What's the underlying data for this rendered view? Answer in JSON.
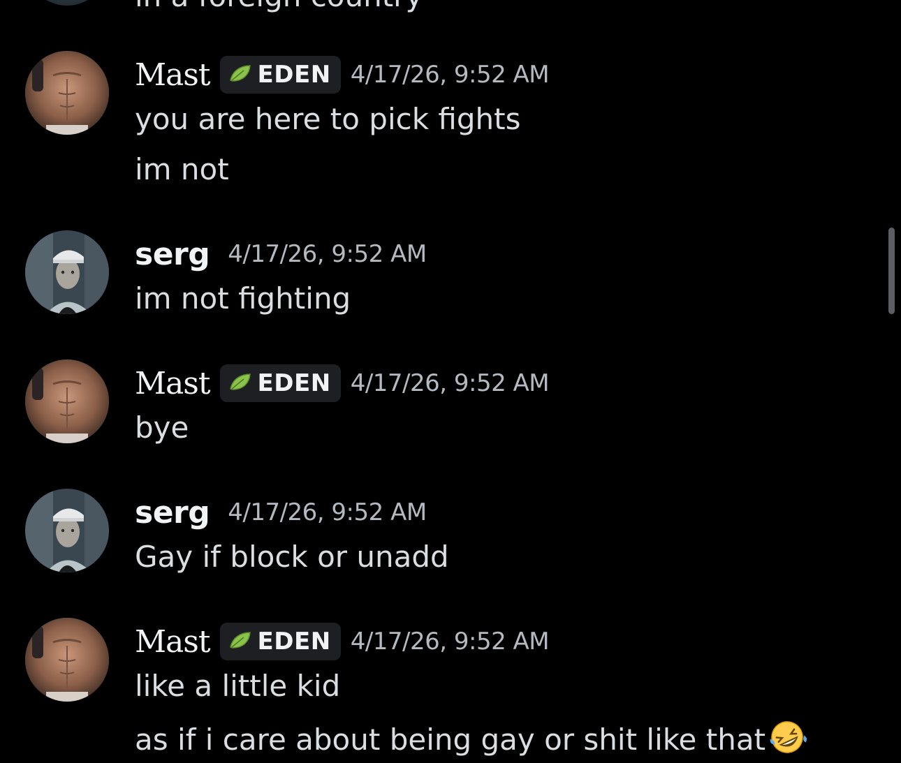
{
  "chat": {
    "cut_off_message": "in a foreign country",
    "messages": [
      {
        "author": "Mast",
        "tag": "EDEN",
        "timestamp": "4/17/26, 9:52 AM",
        "lines": [
          "you are here to pick fights",
          "im not"
        ]
      },
      {
        "author": "serg",
        "timestamp": "4/17/26, 9:52 AM",
        "lines": [
          "im not fighting"
        ]
      },
      {
        "author": "Mast",
        "tag": "EDEN",
        "timestamp": "4/17/26, 9:52 AM",
        "lines": [
          "bye"
        ]
      },
      {
        "author": "serg",
        "timestamp": "4/17/26, 9:52 AM",
        "lines": [
          "Gay if block or unadd"
        ]
      },
      {
        "author": "Mast",
        "tag": "EDEN",
        "timestamp": "4/17/26, 9:52 AM",
        "lines": [
          "like a little kid",
          "as if i care about being gay or shit like that"
        ],
        "trailing_emoji": "rolling-on-floor-laughing"
      }
    ]
  },
  "icons": {
    "tag_icon": "leaf-icon",
    "tag_icon_color": "#8bc34a"
  },
  "colors": {
    "background": "#000000",
    "username": "#f2f3f5",
    "message_text": "#dbdee1",
    "timestamp": "#b5bac1",
    "tag_background": "#1e1f22",
    "scrollbar": "#5c5e66"
  }
}
